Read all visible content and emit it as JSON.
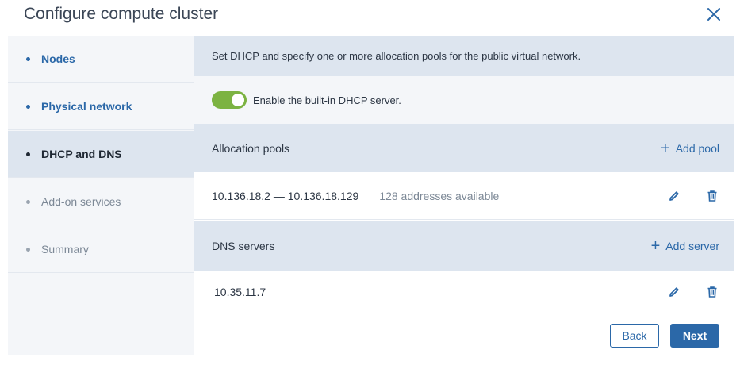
{
  "dialog": {
    "title": "Configure compute cluster",
    "close_icon": "close-icon"
  },
  "steps": [
    {
      "label": "Nodes",
      "state": "done"
    },
    {
      "label": "Physical network",
      "state": "done"
    },
    {
      "label": "DHCP and DNS",
      "state": "active"
    },
    {
      "label": "Add-on services",
      "state": "future"
    },
    {
      "label": "Summary",
      "state": "future"
    }
  ],
  "main": {
    "intro": "Set DHCP and specify one or more allocation pools for the public virtual network.",
    "dhcp_toggle": {
      "label": "Enable the built-in DHCP server.",
      "enabled": true
    },
    "allocation_pools": {
      "heading": "Allocation pools",
      "add_label": "Add pool",
      "items": [
        {
          "range": "10.136.18.2 — 10.136.18.129",
          "available": "128 addresses available"
        }
      ]
    },
    "dns_servers": {
      "heading": "DNS servers",
      "add_label": "Add server",
      "items": [
        {
          "address": "10.35.11.7"
        }
      ]
    }
  },
  "footer": {
    "back_label": "Back",
    "next_label": "Next"
  },
  "colors": {
    "accent": "#2b68a8",
    "toggle_on": "#7cb342",
    "header_band": "#dde5ef",
    "light_band": "#f4f6f9"
  }
}
